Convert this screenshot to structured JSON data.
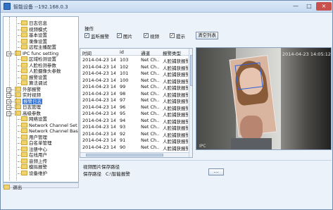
{
  "window": {
    "title": "智能设备 --192.168.0.3"
  },
  "tree": {
    "items": [
      {
        "label": "日志信息",
        "level": 2,
        "icon": "folder"
      },
      {
        "label": "视频模式",
        "level": 2,
        "icon": "folder"
      },
      {
        "label": "基本设置",
        "level": 2,
        "icon": "folder"
      },
      {
        "label": "录像设置",
        "level": 2,
        "icon": "folder"
      },
      {
        "label": "远程主播配置",
        "level": 2,
        "icon": "folder"
      },
      {
        "label": "IPC func setting",
        "level": 1,
        "icon": "folder"
      },
      {
        "label": "区域检测设置",
        "level": 2,
        "icon": "folder"
      },
      {
        "label": "人脸检测参数",
        "level": 2,
        "icon": "folder"
      },
      {
        "label": "人脸摄像头参数",
        "level": 2,
        "icon": "folder"
      },
      {
        "label": "报警设置",
        "level": 2,
        "icon": "folder"
      },
      {
        "label": "算法调试",
        "level": 2,
        "icon": "folder"
      },
      {
        "label": "外部报警",
        "level": 1,
        "icon": "folder"
      },
      {
        "label": "实时视频",
        "level": 1,
        "icon": "folder"
      },
      {
        "label": "报警日志",
        "level": 1,
        "icon": "folder",
        "selected": true
      },
      {
        "label": "日志管理",
        "level": 1,
        "icon": "folder"
      },
      {
        "label": "高级参数",
        "level": 1,
        "icon": "folder"
      },
      {
        "label": "网络设置",
        "level": 2,
        "icon": "folder"
      },
      {
        "label": "Network Channel Set",
        "level": 2,
        "icon": "folder"
      },
      {
        "label": "Network Channel Bas",
        "level": 2,
        "icon": "folder"
      },
      {
        "label": "用户管理",
        "level": 2,
        "icon": "folder"
      },
      {
        "label": "白名单管理",
        "level": 2,
        "icon": "folder"
      },
      {
        "label": "注册中心",
        "level": 2,
        "icon": "folder"
      },
      {
        "label": "在线用户",
        "level": 2,
        "icon": "folder"
      },
      {
        "label": "音频上传",
        "level": 2,
        "icon": "folder"
      },
      {
        "label": "模拟报警",
        "level": 2,
        "icon": "folder"
      },
      {
        "label": "设备维护",
        "level": 2,
        "icon": "folder"
      }
    ],
    "exit_label": "退出"
  },
  "ops": {
    "label": "操作",
    "checkboxes": [
      {
        "label": "监听报警",
        "checked": true
      },
      {
        "label": "图片",
        "checked": true
      },
      {
        "label": "视频",
        "checked": true
      },
      {
        "label": "提示",
        "checked": true
      }
    ],
    "clear_button": "清空列表"
  },
  "table": {
    "headers": [
      "时间",
      "id",
      "通道",
      "报警类型"
    ],
    "rows": [
      [
        "2014-04-23 14:...",
        "103",
        "Net Ch...",
        "人脸捕获报警"
      ],
      [
        "2014-04-23 14:...",
        "102",
        "Net Ch...",
        "人脸捕获报警"
      ],
      [
        "2014-04-23 14:...",
        "101",
        "Net Ch...",
        "人脸捕获报警"
      ],
      [
        "2014-04-23 14:...",
        "100",
        "Net Ch...",
        "人脸捕获报警"
      ],
      [
        "2014-04-23 14:...",
        "99",
        "Net Ch...",
        "人脸捕获报警"
      ],
      [
        "2014-04-23 14:...",
        "98",
        "Net Ch...",
        "人脸捕获报警"
      ],
      [
        "2014-04-23 14:...",
        "97",
        "Net Ch...",
        "人脸捕获报警"
      ],
      [
        "2014-04-23 14:...",
        "96",
        "Net Ch...",
        "人脸捕获报警"
      ],
      [
        "2014-04-23 14:...",
        "95",
        "Net Ch...",
        "人脸捕获报警"
      ],
      [
        "2014-04-23 14:...",
        "94",
        "Net Ch...",
        "人脸捕获报警"
      ],
      [
        "2014-04-23 14:...",
        "93",
        "Net Ch...",
        "人脸捕获报警"
      ],
      [
        "2014-04-23 14:...",
        "92",
        "Net Ch...",
        "人脸捕获报警"
      ],
      [
        "2014-04-23 14:...",
        "91",
        "Net Ch...",
        "人脸捕获报警"
      ],
      [
        "2014-04-23 14:...",
        "90",
        "Net Ch...",
        "人脸捕获报警"
      ]
    ]
  },
  "preview": {
    "timestamp": "2014-04-23 14:05:12",
    "watermark": "IPC"
  },
  "path": {
    "title": "视频图片保存路径",
    "label": "保存路径",
    "value": "C:\\智能报警",
    "browse": "..."
  }
}
